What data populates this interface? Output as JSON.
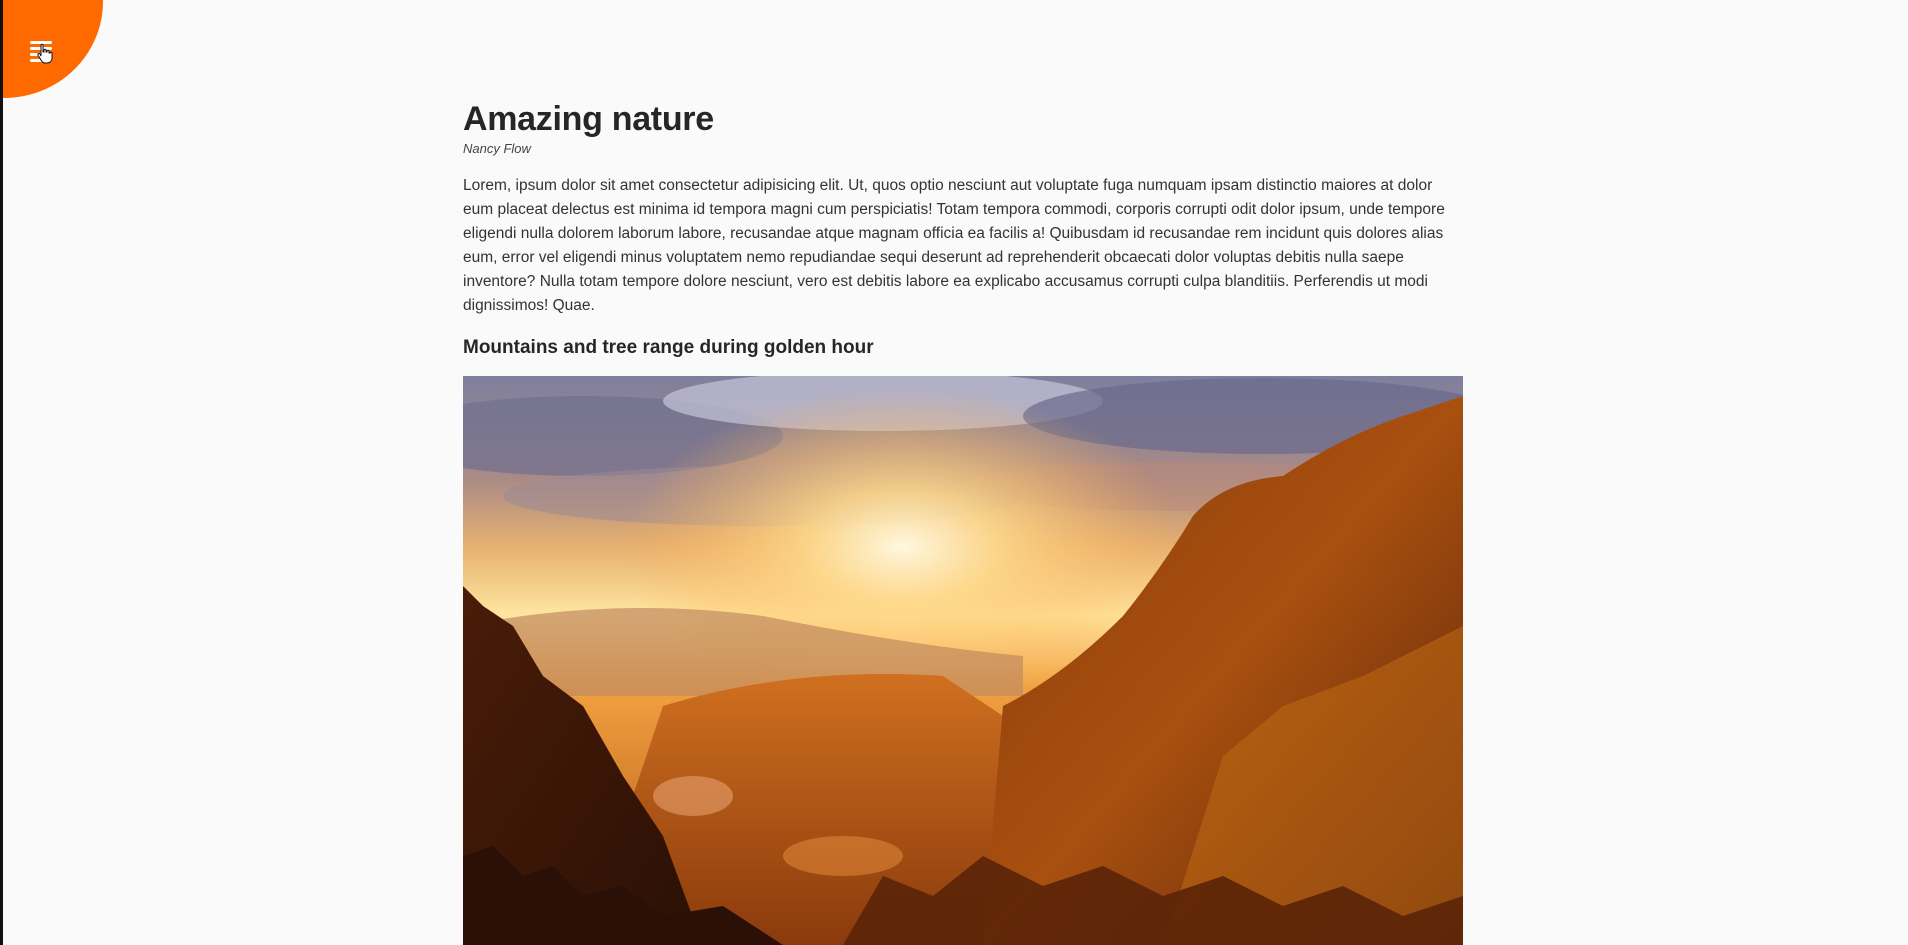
{
  "menu": {
    "icon": "hamburger-menu-icon",
    "accent_color": "#ff6a00"
  },
  "article": {
    "title": "Amazing nature",
    "author": "Nancy Flow",
    "body": "Lorem, ipsum dolor sit amet consectetur adipisicing elit. Ut, quos optio nesciunt aut voluptate fuga numquam ipsam distinctio maiores at dolor eum placeat delectus est minima id tempora magni cum perspiciatis! Totam tempora commodi, corporis corrupti odit dolor ipsum, unde tempore eligendi nulla dolorem laborum labore, recusandae atque magnam officia ea facilis a! Quibusdam id recusandae rem incidunt quis dolores alias eum, error vel eligendi minus voluptatem nemo repudiandae sequi deserunt ad reprehenderit obcaecati dolor voluptas debitis nulla saepe inventore? Nulla totam tempore dolore nesciunt, vero est debitis labore ea explicabo accusamus corrupti culpa blanditiis. Perferendis ut modi dignissimos! Quae.",
    "subtitle": "Mountains and tree range during golden hour"
  }
}
